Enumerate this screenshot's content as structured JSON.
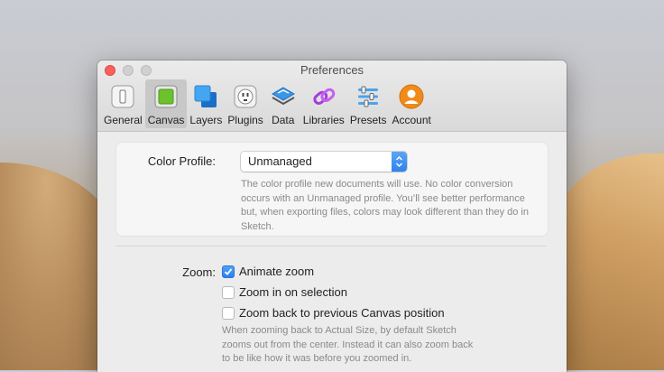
{
  "window": {
    "title": "Preferences"
  },
  "tabs": [
    {
      "label": "General",
      "icon": "general-icon",
      "active": false
    },
    {
      "label": "Canvas",
      "icon": "canvas-icon",
      "active": true
    },
    {
      "label": "Layers",
      "icon": "layers-icon",
      "active": false
    },
    {
      "label": "Plugins",
      "icon": "plugins-icon",
      "active": false
    },
    {
      "label": "Data",
      "icon": "data-icon",
      "active": false
    },
    {
      "label": "Libraries",
      "icon": "libraries-icon",
      "active": false
    },
    {
      "label": "Presets",
      "icon": "presets-icon",
      "active": false
    },
    {
      "label": "Account",
      "icon": "account-icon",
      "active": false
    }
  ],
  "color_profile": {
    "label": "Color Profile:",
    "value": "Unmanaged",
    "help": [
      "The color profile new documents will use. No color conversion",
      "occurs with an Unmanaged profile. You’ll see better performance",
      "but, when exporting files, colors may look different than they do in",
      "Sketch."
    ]
  },
  "zoom": {
    "label": "Zoom:",
    "options": [
      {
        "label": "Animate zoom",
        "checked": true
      },
      {
        "label": "Zoom in on selection",
        "checked": false
      },
      {
        "label": "Zoom back to previous Canvas position",
        "checked": false
      }
    ],
    "help": [
      "When zooming back to Actual Size, by default Sketch",
      "zooms out from the center. Instead it can also zoom back",
      "to be like how it was before you zoomed in."
    ]
  },
  "colors": {
    "accent": "#2f81ef",
    "close": "#fc605c"
  }
}
